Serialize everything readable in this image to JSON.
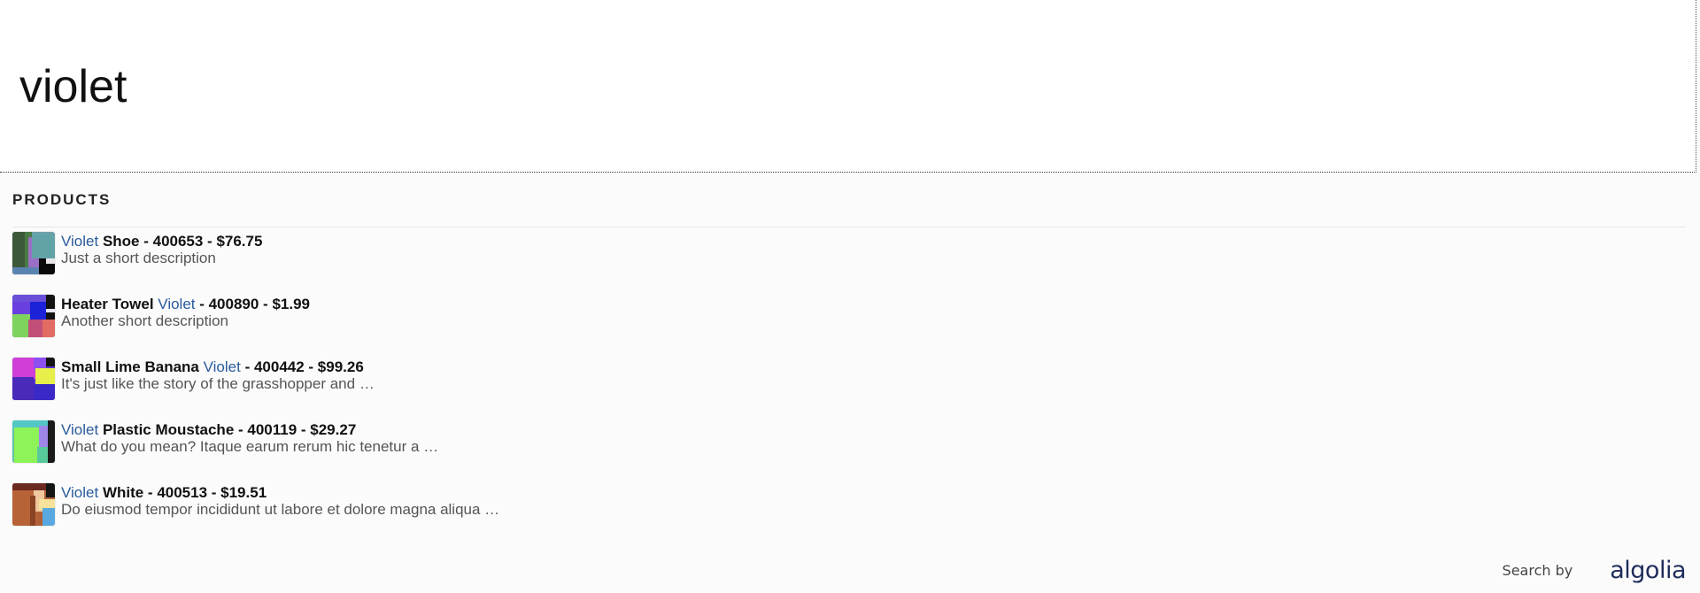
{
  "search": {
    "value": "violet"
  },
  "panel": {
    "section_title": "PRODUCTS"
  },
  "colors": {
    "highlight": "#2a5b9c",
    "title_text": "#111111",
    "description_text": "#555555",
    "logo": "#1f2c5c"
  },
  "results": [
    {
      "title_before": "",
      "highlight": "Violet",
      "title_after": " Shoe - 400653 - $76.75",
      "description": "Just a short description",
      "thumb_icon": "product-image"
    },
    {
      "title_before": "Heater Towel ",
      "highlight": "Violet",
      "title_after": " - 400890 - $1.99",
      "description": "Another short description",
      "thumb_icon": "product-image"
    },
    {
      "title_before": "Small Lime Banana ",
      "highlight": "Violet",
      "title_after": " - 400442 - $99.26",
      "description": "It's just like the story of the grasshopper and …",
      "thumb_icon": "product-image"
    },
    {
      "title_before": "",
      "highlight": "Violet",
      "title_after": " Plastic Moustache - 400119 - $29.27",
      "description": "What do you mean? Itaque earum rerum hic tenetur a …",
      "thumb_icon": "product-image"
    },
    {
      "title_before": "",
      "highlight": "Violet",
      "title_after": " White - 400513 - $19.51",
      "description": "Do eiusmod tempor incididunt ut labore et dolore magna aliqua …",
      "thumb_icon": "product-image"
    }
  ],
  "footer": {
    "search_by": "Search by",
    "logo_text": "algolia"
  }
}
